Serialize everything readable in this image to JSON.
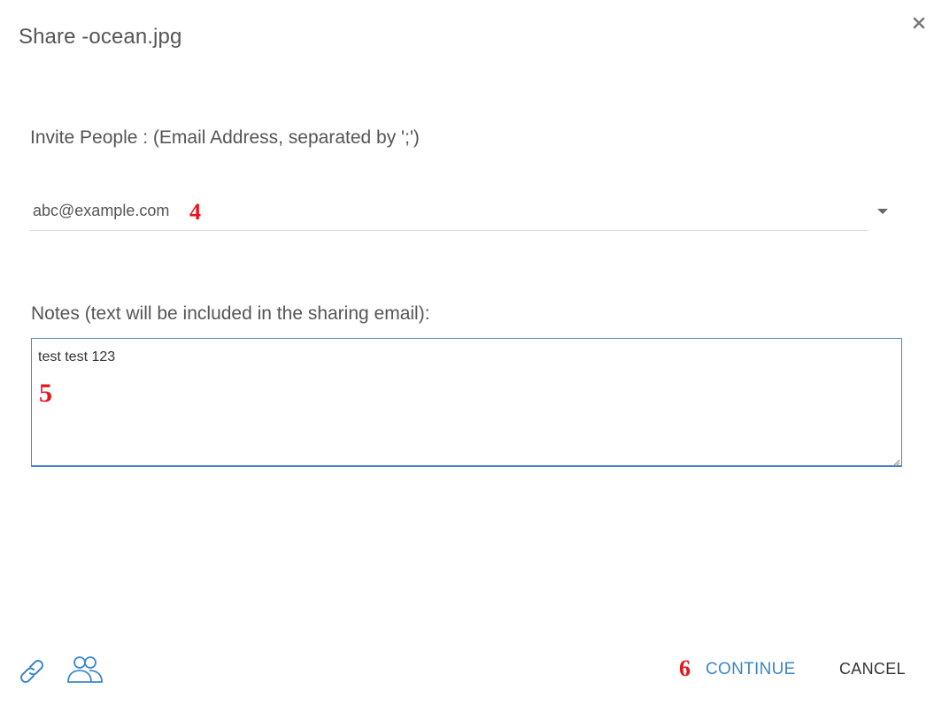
{
  "dialog": {
    "title": "Share -ocean.jpg",
    "close_icon": "close-icon"
  },
  "invite": {
    "label": "Invite People : (Email Address, separated by ';')",
    "value": "abc@example.com",
    "dropdown_icon": "caret-down-icon"
  },
  "notes": {
    "label": "Notes (text will be included in the sharing email):",
    "value": "test test 123"
  },
  "annotations": {
    "step4": "4",
    "step5": "5",
    "step6": "6"
  },
  "footer": {
    "link_icon": "link-icon",
    "people_icon": "people-icon",
    "continue_label": "CONTINUE",
    "cancel_label": "CANCEL"
  },
  "colors": {
    "accent": "#3a87c8",
    "annotation": "#e8141b",
    "text": "#555555"
  }
}
